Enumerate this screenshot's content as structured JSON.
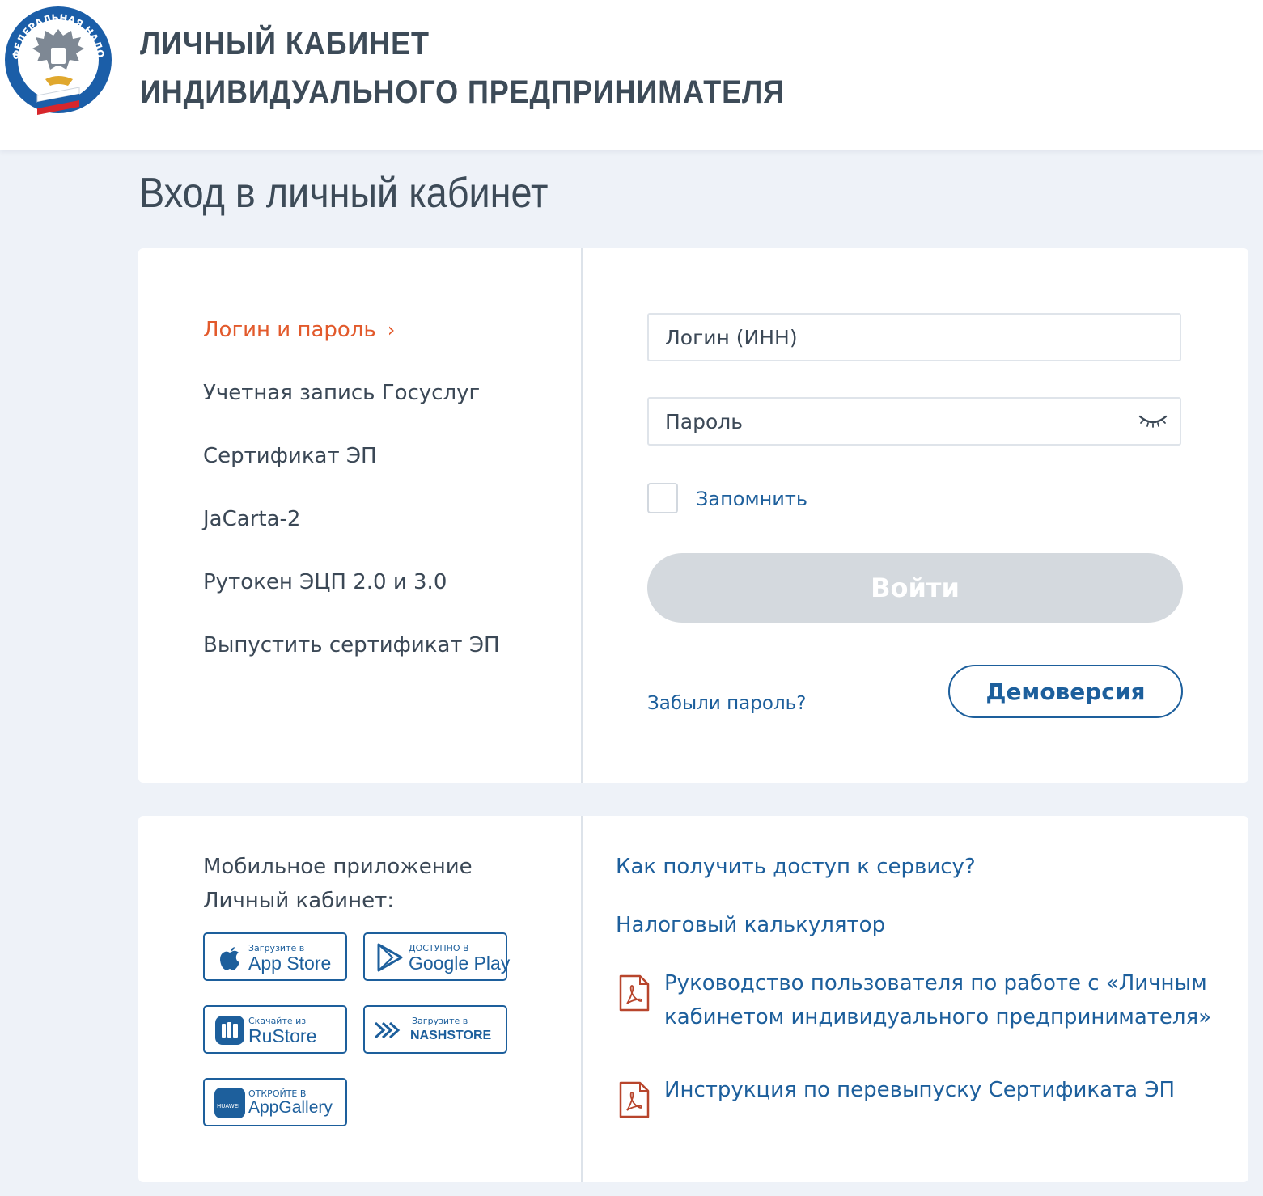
{
  "header": {
    "title_line1": "ЛИЧНЫЙ КАБИНЕТ",
    "title_line2": "ИНДИВИДУАЛЬНОГО ПРЕДПРИНИМАТЕЛЯ",
    "logo_text": "ФЕДЕРАЛЬНАЯ НАЛОГОВАЯ СЛУЖБА"
  },
  "page": {
    "title": "Вход в личный кабинет"
  },
  "login_methods": [
    {
      "label": "Логин и пароль",
      "active": true
    },
    {
      "label": "Учетная запись Госуслуг"
    },
    {
      "label": "Сертификат ЭП"
    },
    {
      "label": "JaCarta-2"
    },
    {
      "label": "Рутокен ЭЦП 2.0 и 3.0"
    },
    {
      "label": "Выпустить сертификат ЭП"
    }
  ],
  "form": {
    "login_placeholder": "Логин (ИНН)",
    "password_placeholder": "Пароль",
    "remember_label": "Запомнить",
    "submit_label": "Войти",
    "forgot_label": "Забыли пароль?",
    "demo_label": "Демоверсия"
  },
  "mobile": {
    "title_line1": "Мобильное приложение",
    "title_line2": "Личный кабинет:",
    "stores": {
      "appstore": {
        "small": "Загрузите в",
        "big": "App Store"
      },
      "gplay": {
        "small": "ДОСТУПНО В",
        "big": "Google Play"
      },
      "rustore": {
        "small": "Скачайте из",
        "big": "RuStore"
      },
      "nashstore": {
        "small": "Загрузите в",
        "big": "NASHSTORE"
      },
      "appgallery": {
        "small": "ОТКРОЙТЕ В",
        "big": "AppGallery",
        "brand": "HUAWEI"
      }
    }
  },
  "links": {
    "access": "Как получить доступ к сервису?",
    "calculator": "Налоговый калькулятор",
    "guide_line1": "Руководство пользователя по работе с «Личным",
    "guide_line2": "кабинетом индивидуального предпринимателя»",
    "instruction": "Инструкция по перевыпуску Сертификата ЭП"
  },
  "colors": {
    "accent_orange": "#e25a2c",
    "link_blue": "#1d5f9c",
    "button_disabled": "#d4d9de",
    "background": "#eef2f8"
  }
}
